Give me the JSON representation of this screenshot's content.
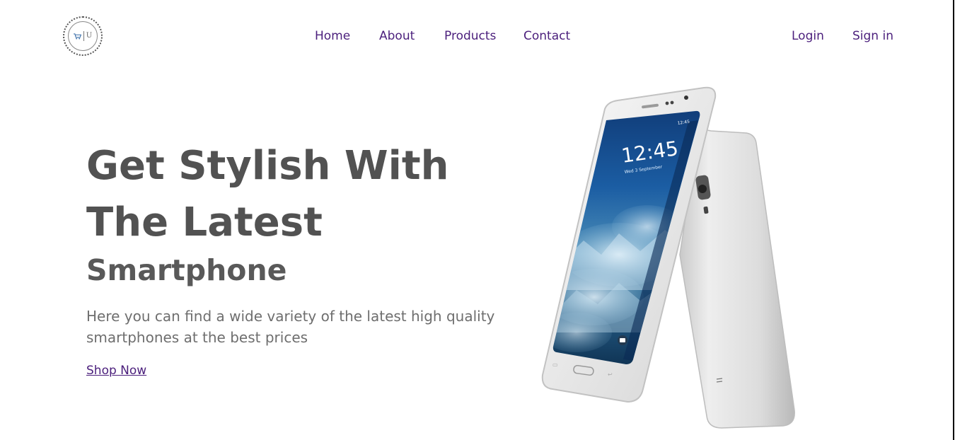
{
  "header": {
    "logo": {
      "icon": "shopping-cart-icon",
      "letter": "U"
    },
    "nav": [
      {
        "label": "Home"
      },
      {
        "label": "About"
      },
      {
        "label": "Products"
      },
      {
        "label": "Contact"
      }
    ],
    "auth": {
      "login_label": "Login",
      "signin_label": "Sign in"
    }
  },
  "hero": {
    "title_line1": "Get Stylish With",
    "title_line2": "The Latest",
    "subtitle": "Smartphone",
    "description": "Here you can find a wide variety of the latest high quality smartphones at the best prices",
    "cta_label": "Shop Now",
    "phone_clock": "12:45",
    "phone_status_time": "12:45",
    "phone_date": "Wed 3 September"
  },
  "colors": {
    "link": "#4b1f7c",
    "heading": "#525252",
    "body_text": "#6e6e6e",
    "background": "#ffffff"
  }
}
